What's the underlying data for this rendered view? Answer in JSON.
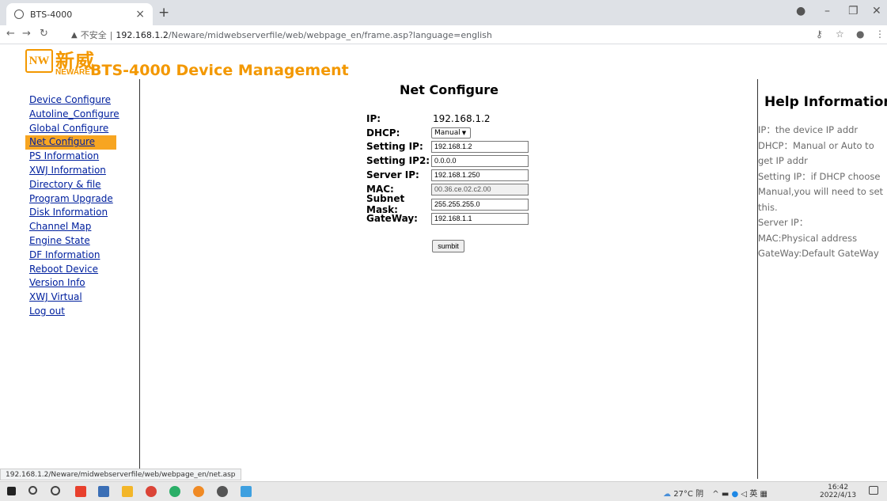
{
  "browser": {
    "tab_title": "BTS-4000",
    "tab_close": "×",
    "new_tab": "+",
    "address_warning": "▲",
    "address_insecure": "不安全",
    "address_separator": "|",
    "address_host": "192.168.1.2",
    "address_path": "/Neware/midwebserverfile/web/webpage_en/frame.asp?language=english",
    "status_url": "192.168.1.2/Neware/midwebserverfile/web/webpage_en/net.asp"
  },
  "header": {
    "logo_mark": "NW",
    "logo_cn": "新威",
    "logo_en": "NEWARE",
    "title": "BTS-4000 Device Management"
  },
  "nav": {
    "items": [
      {
        "label": "Device Configure"
      },
      {
        "label": "Autoline_Configure"
      },
      {
        "label": "Global Configure"
      },
      {
        "label": "Net Configure",
        "active": true
      },
      {
        "label": "PS Information"
      },
      {
        "label": "XWJ Information"
      },
      {
        "label": "Directory & file"
      },
      {
        "label": "Program Upgrade"
      },
      {
        "label": "Disk Information"
      },
      {
        "label": "Channel Map"
      },
      {
        "label": "Engine State"
      },
      {
        "label": "DF Information"
      },
      {
        "label": "Reboot Device"
      },
      {
        "label": "Version Info"
      },
      {
        "label": "XWJ Virtual"
      },
      {
        "label": "Log out"
      }
    ]
  },
  "form": {
    "title": "Net Configure",
    "ip_label": "IP:",
    "ip_value": "192.168.1.2",
    "dhcp_label": "DHCP:",
    "dhcp_value": "Manual",
    "setting_ip_label": "Setting IP:",
    "setting_ip_value": "192.168.1.2",
    "setting_ip2_label": "Setting IP2:",
    "setting_ip2_value": "0.0.0.0",
    "server_ip_label": "Server IP:",
    "server_ip_value": "192.168.1.250",
    "mac_label": "MAC:",
    "mac_value": "00.36.ce.02.c2.00",
    "subnet_label": "Subnet Mask:",
    "subnet_value": "255.255.255.0",
    "gateway_label": "GateWay:",
    "gateway_value": "192.168.1.1",
    "submit_label": "sumbit"
  },
  "help": {
    "title": "Help Information",
    "lines": [
      "IP：the device IP addr",
      "DHCP：Manual or Auto to get IP addr",
      "Setting IP：if DHCP choose Manual,you will need to set this.",
      "Server IP：",
      "MAC:Physical address",
      "GateWay:Default GateWay"
    ]
  },
  "taskbar": {
    "weather": "27°C 阴",
    "ime": "英",
    "time": "16:42",
    "date": "2022/4/13"
  }
}
